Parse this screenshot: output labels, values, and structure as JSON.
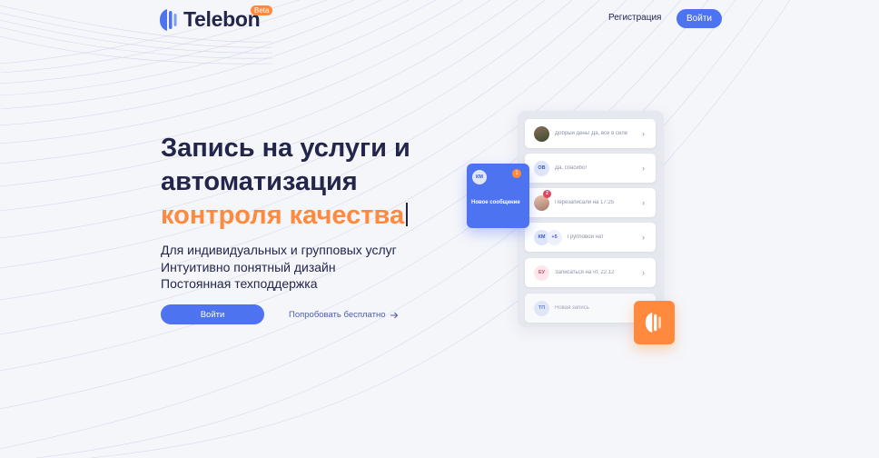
{
  "header": {
    "logo_text": "Telebon",
    "beta_label": "Beta",
    "register_label": "Регистрация",
    "login_label": "Войти"
  },
  "hero": {
    "title_line1": "Запись на услуги и",
    "title_line2": "автоматизация",
    "title_accent": "контроля качества",
    "features": [
      "Для индивидуальных и групповых услуг",
      "Интуитивно понятный дизайн",
      "Постоянная техподдержка"
    ],
    "cta_login": "Войти",
    "cta_try": "Попробовать бесплатно"
  },
  "mockup": {
    "messages": [
      {
        "avatar": "",
        "text": "Добрый день! Да, все в силе"
      },
      {
        "avatar": "ОВ",
        "text": "Да, спасибо!"
      },
      {
        "avatar": "",
        "badge": "2",
        "text": "Перезаписали на 17:25"
      },
      {
        "avatar": "КМ",
        "extra": "+5",
        "text": "Групповой чат"
      },
      {
        "avatar": "ЕУ",
        "text": "Записаться на чт, 22.12"
      },
      {
        "avatar": "ТП",
        "text": "Новая запись"
      }
    ],
    "notification": {
      "avatar": "КМ",
      "count": "1",
      "label": "Новое сообщение"
    }
  },
  "colors": {
    "primary": "#4e73f0",
    "accent": "#ff8a3d",
    "text": "#23264a",
    "background": "#f5f6fa"
  }
}
